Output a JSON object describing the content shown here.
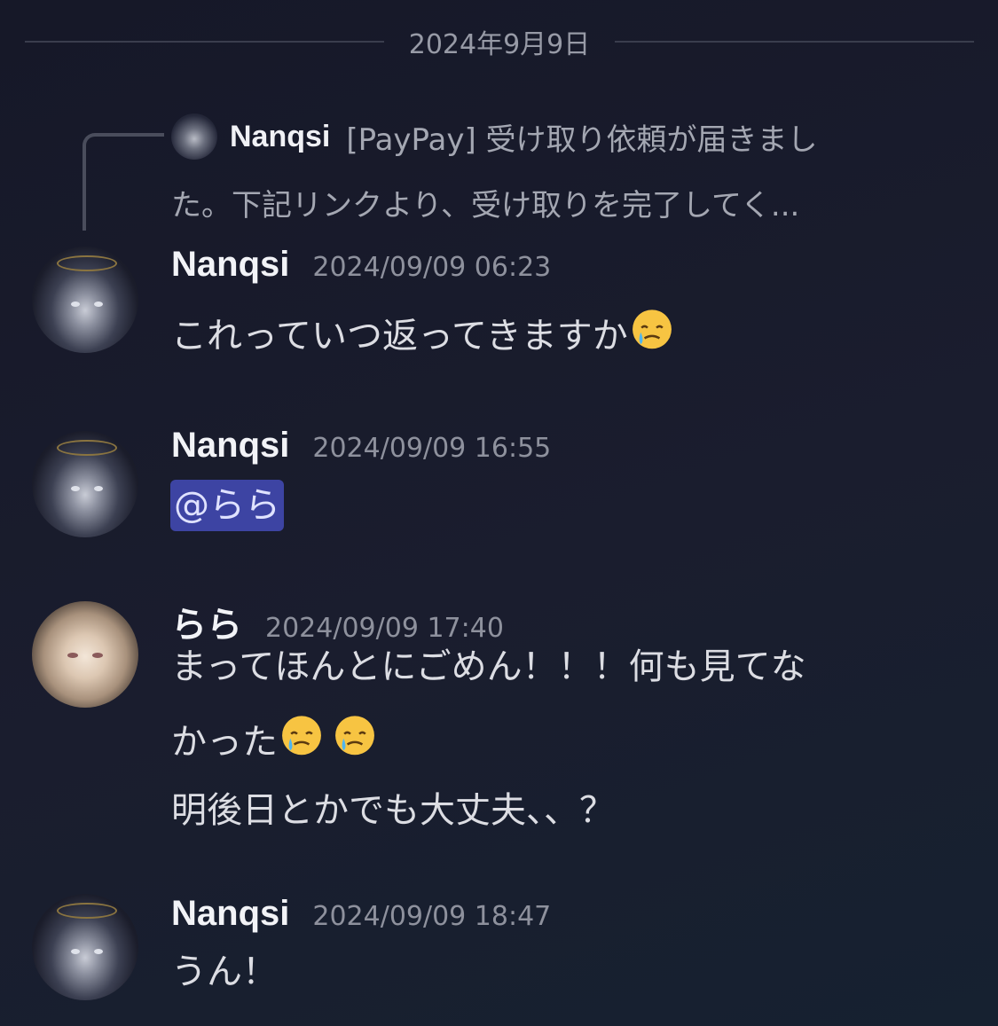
{
  "date_divider": "2024年9月9日",
  "reply": {
    "author": "Nanqsi",
    "preview_line1": "[PayPay] 受け取り依頼が届きまし",
    "preview_line2": "た。下記リンクより、受け取りを完了してく..."
  },
  "messages": [
    {
      "author": "Nanqsi",
      "timestamp": "2024/09/09 06:23",
      "text": "これっていつ返ってきますか",
      "emoji": "face-holding-back-tears-emoji"
    },
    {
      "author": "Nanqsi",
      "timestamp": "2024/09/09 16:55",
      "mention": "@らら"
    },
    {
      "author": "らら",
      "timestamp": "2024/09/09 17:40",
      "line1": "まってほんとにごめん！！！何も見てな",
      "line2": "かった",
      "line3": "明後日とかでも大丈夫、、？",
      "emoji": "face-holding-back-tears-emoji"
    },
    {
      "author": "Nanqsi",
      "timestamp": "2024/09/09 18:47",
      "text": "うん！"
    }
  ],
  "colors": {
    "background": "#1a1d2e",
    "mention_bg": "#3d44a3",
    "muted_text": "#8e919d"
  }
}
